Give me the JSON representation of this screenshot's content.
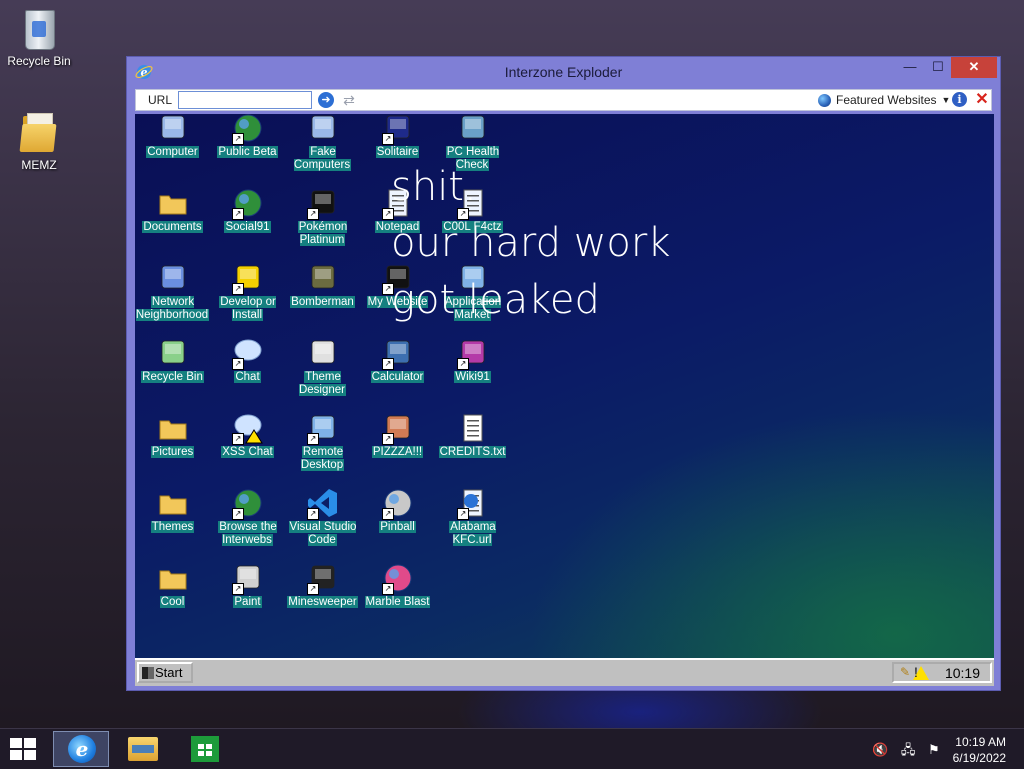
{
  "desktop": {
    "icons": [
      {
        "label": "Recycle Bin",
        "icon": "recycle-bin-icon"
      },
      {
        "label": "MEMZ",
        "icon": "folder-icon"
      }
    ]
  },
  "window": {
    "title": "Interzone Exploder",
    "controls": {
      "minimize": "—",
      "maximize": "☐",
      "close": "✕"
    },
    "toolbar": {
      "url_label": "URL",
      "url_value": "",
      "featured_label": "Featured Websites",
      "info_label": "i",
      "stop_label": "✕"
    }
  },
  "sim_desktop": {
    "icons": [
      {
        "label": "Computer",
        "icon": "computer-icon",
        "shortcut": false,
        "color": "#9ab8e8"
      },
      {
        "label": "Public Beta",
        "icon": "globe-icon",
        "shortcut": true,
        "color": "#2f8f3a"
      },
      {
        "label": "Fake Computers",
        "icon": "computer-icon",
        "shortcut": false,
        "color": "#9ab8e8"
      },
      {
        "label": "Solitaire",
        "icon": "cards-icon",
        "shortcut": true,
        "color": "#1e2a8a"
      },
      {
        "label": "PC Health Check",
        "icon": "magnifier-icon",
        "shortcut": false,
        "color": "#6aa0c8"
      },
      {
        "label": "Documents",
        "icon": "folder-open-icon",
        "shortcut": false,
        "color": "#f2c75a"
      },
      {
        "label": "Social91",
        "icon": "globe-icon",
        "shortcut": true,
        "color": "#2f8f3a"
      },
      {
        "label": "Pokémon Platinum",
        "icon": "pokemon-icon",
        "shortcut": true,
        "color": "#111111"
      },
      {
        "label": "Notepad",
        "icon": "notepad-icon",
        "shortcut": true,
        "color": "#7fb2e8"
      },
      {
        "label": "C00L F4ctz",
        "icon": "checklist-icon",
        "shortcut": true,
        "color": "#7fb2e8"
      },
      {
        "label": "Network Neighborhood",
        "icon": "network-icon",
        "shortcut": false,
        "color": "#6a8fe0"
      },
      {
        "label": "Develop or Install",
        "icon": "help-icon",
        "shortcut": true,
        "color": "#f4d000"
      },
      {
        "label": "Bomberman",
        "icon": "bomb-icon",
        "shortcut": false,
        "color": "#6b6b40"
      },
      {
        "label": "My Website",
        "icon": "website-icon",
        "shortcut": true,
        "color": "#111111"
      },
      {
        "label": "Application Market",
        "icon": "lock-icon",
        "shortcut": false,
        "color": "#7fb2e8"
      },
      {
        "label": "Recycle Bin",
        "icon": "recycle-bin-icon",
        "shortcut": false,
        "color": "#8ad08a"
      },
      {
        "label": "Chat",
        "icon": "chat-icon",
        "shortcut": true,
        "color": "#cfe3ff"
      },
      {
        "label": "Theme Designer",
        "icon": "window-icon",
        "shortcut": false,
        "color": "#e0e0e0"
      },
      {
        "label": "Calculator",
        "icon": "calculator-icon",
        "shortcut": true,
        "color": "#3d6fb0"
      },
      {
        "label": "Wiki91",
        "icon": "book-icon",
        "shortcut": true,
        "color": "#b43aa8"
      },
      {
        "label": "Pictures",
        "icon": "folder-icon",
        "shortcut": false,
        "color": "#f2c75a"
      },
      {
        "label": "XSS Chat",
        "icon": "chat-warning-icon",
        "shortcut": true,
        "color": "#cfe3ff"
      },
      {
        "label": "Remote Desktop",
        "icon": "remote-desktop-icon",
        "shortcut": true,
        "color": "#7fb2e8"
      },
      {
        "label": "PIZZZA!!!",
        "icon": "pizza-icon",
        "shortcut": true,
        "color": "#d27b54"
      },
      {
        "label": "CREDITS.txt",
        "icon": "text-file-icon",
        "shortcut": false,
        "color": "#ffffff"
      },
      {
        "label": "Themes",
        "icon": "folder-icon",
        "shortcut": false,
        "color": "#f2c75a"
      },
      {
        "label": "Browse the Interwebs",
        "icon": "globe-icon",
        "shortcut": true,
        "color": "#2f8f3a"
      },
      {
        "label": "Visual Studio Code",
        "icon": "vscode-icon",
        "shortcut": true,
        "color": "#2a8ee8"
      },
      {
        "label": "Pinball",
        "icon": "pinball-icon",
        "shortcut": true,
        "color": "#c8c8c8"
      },
      {
        "label": "Alabama KFC.url",
        "icon": "ie-document-icon",
        "shortcut": true,
        "color": "#2a72d6"
      },
      {
        "label": "Cool",
        "icon": "folder-icon",
        "shortcut": false,
        "color": "#f2c75a"
      },
      {
        "label": "Paint",
        "icon": "paint-icon",
        "shortcut": true,
        "color": "#d0d0d0"
      },
      {
        "label": "Minesweeper",
        "icon": "mine-icon",
        "shortcut": true,
        "color": "#222222"
      },
      {
        "label": "Marble Blast",
        "icon": "marble-icon",
        "shortcut": true,
        "color": "#e04a8a"
      }
    ],
    "overlay_lines": [
      "shit.",
      "our hard work",
      "got leaked"
    ],
    "taskbar": {
      "start_label": "Start",
      "clock": "10:19"
    }
  },
  "host_taskbar": {
    "time": "10:19 AM",
    "date": "6/19/2022"
  }
}
